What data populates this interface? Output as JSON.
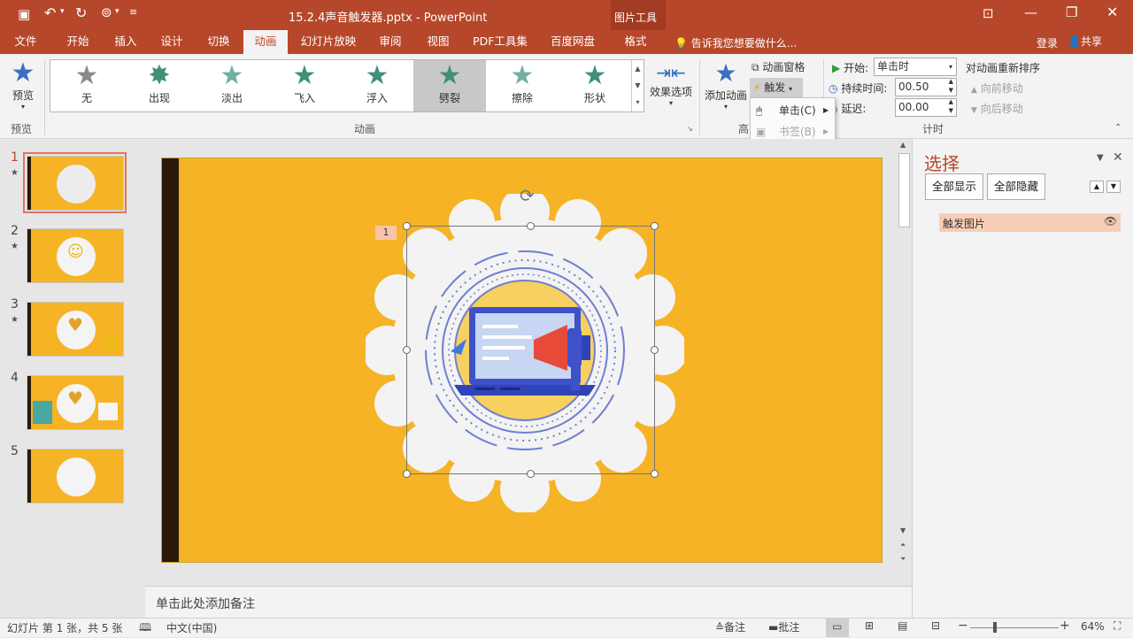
{
  "window": {
    "title": "15.2.4声音触发器.pptx - PowerPoint",
    "context_tool": "图片工具"
  },
  "tabs": [
    {
      "label": "文件"
    },
    {
      "label": "开始"
    },
    {
      "label": "插入"
    },
    {
      "label": "设计"
    },
    {
      "label": "切换"
    },
    {
      "label": "动画"
    },
    {
      "label": "幻灯片放映"
    },
    {
      "label": "审阅"
    },
    {
      "label": "视图"
    },
    {
      "label": "PDF工具集"
    },
    {
      "label": "百度网盘"
    },
    {
      "label": "格式"
    }
  ],
  "active_tab": "动画",
  "tell_me": "告诉我您想要做什么...",
  "account": {
    "login": "登录",
    "share": "共享"
  },
  "ribbon": {
    "preview": {
      "label": "预览",
      "group": "预览"
    },
    "animations_group": "动画",
    "gallery": [
      {
        "label": "无",
        "color": "#8a8a8a"
      },
      {
        "label": "出现",
        "color": "#3f8f7b"
      },
      {
        "label": "淡出",
        "color": "#6fb0a0"
      },
      {
        "label": "飞入",
        "color": "#3f8f7b"
      },
      {
        "label": "浮入",
        "color": "#3f8f7b"
      },
      {
        "label": "劈裂",
        "color": "#3f8f7b"
      },
      {
        "label": "擦除",
        "color": "#6fb0a0"
      },
      {
        "label": "形状",
        "color": "#3f8f7b"
      }
    ],
    "selected_effect": "劈裂",
    "effect_options": "效果选项",
    "add_animation": "添加动画",
    "animation_pane": "动画窗格",
    "trigger": "触发",
    "advanced_group_partial": "高",
    "timing": {
      "start_label": "开始:",
      "start_value": "单击时",
      "duration_label": "持续时间:",
      "duration_value": "00.50",
      "delay_label": "延迟:",
      "delay_value": "00.00",
      "group": "计时"
    },
    "reorder": {
      "title": "对动画重新排序",
      "move_earlier": "向前移动",
      "move_later": "向后移动"
    }
  },
  "trigger_menu": {
    "on_click": "单击(C)",
    "on_bookmark": "书签(B)"
  },
  "slides": [
    {
      "num": "1",
      "star": "★"
    },
    {
      "num": "2",
      "star": "★"
    },
    {
      "num": "3",
      "star": "★"
    },
    {
      "num": "4",
      "star": ""
    },
    {
      "num": "5",
      "star": ""
    }
  ],
  "canvas": {
    "animation_tag": "1",
    "bg_color": "#f5b325",
    "band_color": "#2a1a0a"
  },
  "notes_placeholder": "单击此处添加备注",
  "selection_pane": {
    "title": "选择",
    "show_all": "全部显示",
    "hide_all": "全部隐藏",
    "items": [
      {
        "name": "触发图片"
      }
    ]
  },
  "status": {
    "slide_info": "幻灯片 第 1 张，共 5 张",
    "language": "中文(中国)",
    "notes": "备注",
    "comments": "批注",
    "zoom": "64%"
  }
}
